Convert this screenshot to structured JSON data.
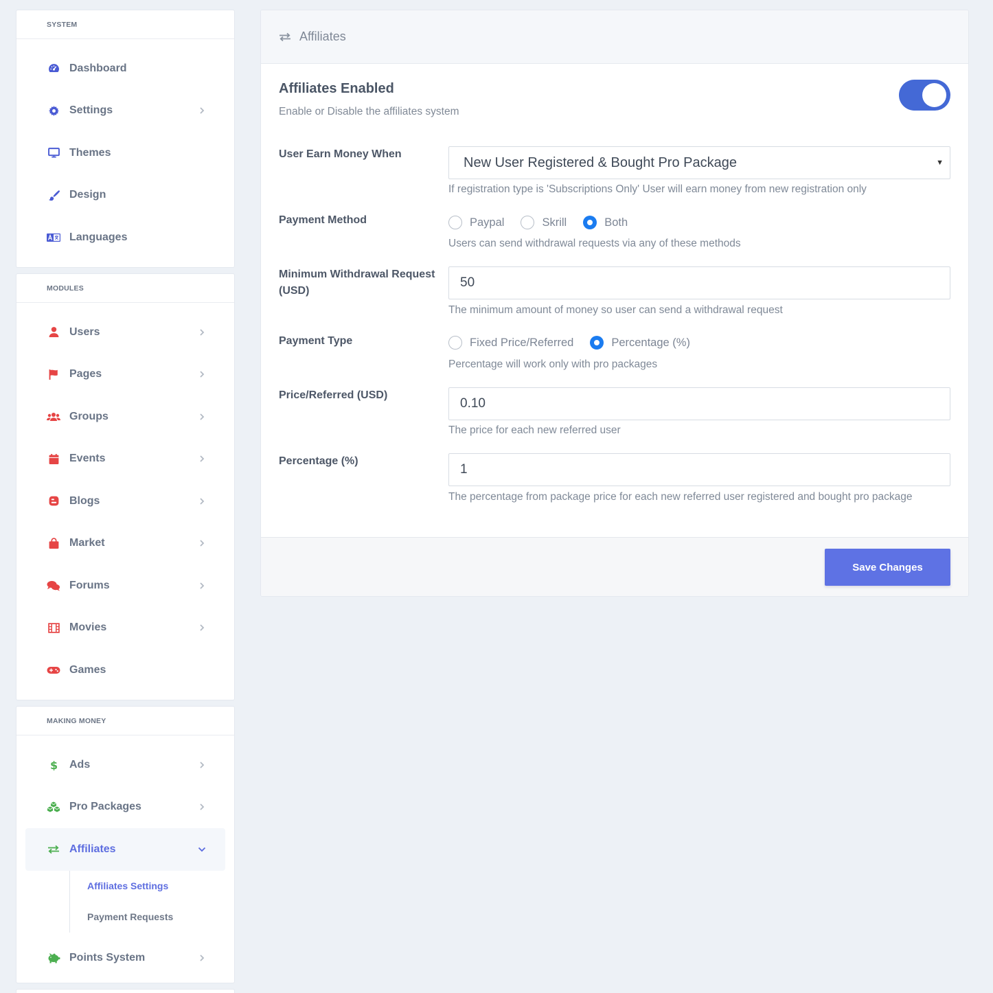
{
  "sidebar": {
    "system": {
      "title": "SYSTEM",
      "items": [
        {
          "label": "Dashboard",
          "icon": "gauge-icon"
        },
        {
          "label": "Settings",
          "icon": "gear-icon"
        },
        {
          "label": "Themes",
          "icon": "monitor-icon"
        },
        {
          "label": "Design",
          "icon": "paintbrush-icon"
        },
        {
          "label": "Languages",
          "icon": "language-icon"
        }
      ]
    },
    "modules": {
      "title": "MODULES",
      "items": [
        {
          "label": "Users",
          "icon": "user-icon"
        },
        {
          "label": "Pages",
          "icon": "flag-icon"
        },
        {
          "label": "Groups",
          "icon": "users-group-icon"
        },
        {
          "label": "Events",
          "icon": "calendar-icon"
        },
        {
          "label": "Blogs",
          "icon": "blogger-icon"
        },
        {
          "label": "Market",
          "icon": "shopping-bag-icon"
        },
        {
          "label": "Forums",
          "icon": "comments-icon"
        },
        {
          "label": "Movies",
          "icon": "film-icon"
        },
        {
          "label": "Games",
          "icon": "gamepad-icon"
        }
      ]
    },
    "money": {
      "title": "MAKING MONEY",
      "items": [
        {
          "label": "Ads",
          "icon": "dollar-icon"
        },
        {
          "label": "Pro Packages",
          "icon": "cubes-icon"
        },
        {
          "label": "Affiliates",
          "icon": "exchange-icon"
        },
        {
          "label": "Points System",
          "icon": "piggy-bank-icon"
        }
      ],
      "affiliates_sub": [
        "Affiliates Settings",
        "Payment Requests"
      ]
    }
  },
  "main": {
    "header_title": "Affiliates",
    "enabled": {
      "title": "Affiliates Enabled",
      "description": "Enable or Disable the affiliates system",
      "on": true
    },
    "earn": {
      "label": "User Earn Money When",
      "value": "New User Registered & Bought Pro Package",
      "help": "If registration type is 'Subscriptions Only' User will earn money from new registration only"
    },
    "payment_method": {
      "label": "Payment Method",
      "options": [
        "Paypal",
        "Skrill",
        "Both"
      ],
      "selected": "Both",
      "help": "Users can send withdrawal requests via any of these methods"
    },
    "min_withdrawal": {
      "label": "Minimum Withdrawal Request (USD)",
      "value": "50",
      "help": "The minimum amount of money so user can send a withdrawal request"
    },
    "payment_type": {
      "label": "Payment Type",
      "options": [
        "Fixed Price/Referred",
        "Percentage (%)"
      ],
      "selected": "Percentage (%)",
      "help": "Percentage will work only with pro packages"
    },
    "price_referred": {
      "label": "Price/Referred (USD)",
      "value": "0.10",
      "help": "The price for each new referred user"
    },
    "percentage": {
      "label": "Percentage (%)",
      "value": "1",
      "help": "The percentage from package price for each new referred user registered and bought pro package"
    },
    "save_label": "Save Changes"
  },
  "colors": {
    "system_icons": "#4a5bd4",
    "module_icons": "#e64545",
    "money_icons": "#4caf50",
    "accent": "#5e72e4",
    "toggle": "#4469d6",
    "radio_checked": "#1b7cf0"
  }
}
